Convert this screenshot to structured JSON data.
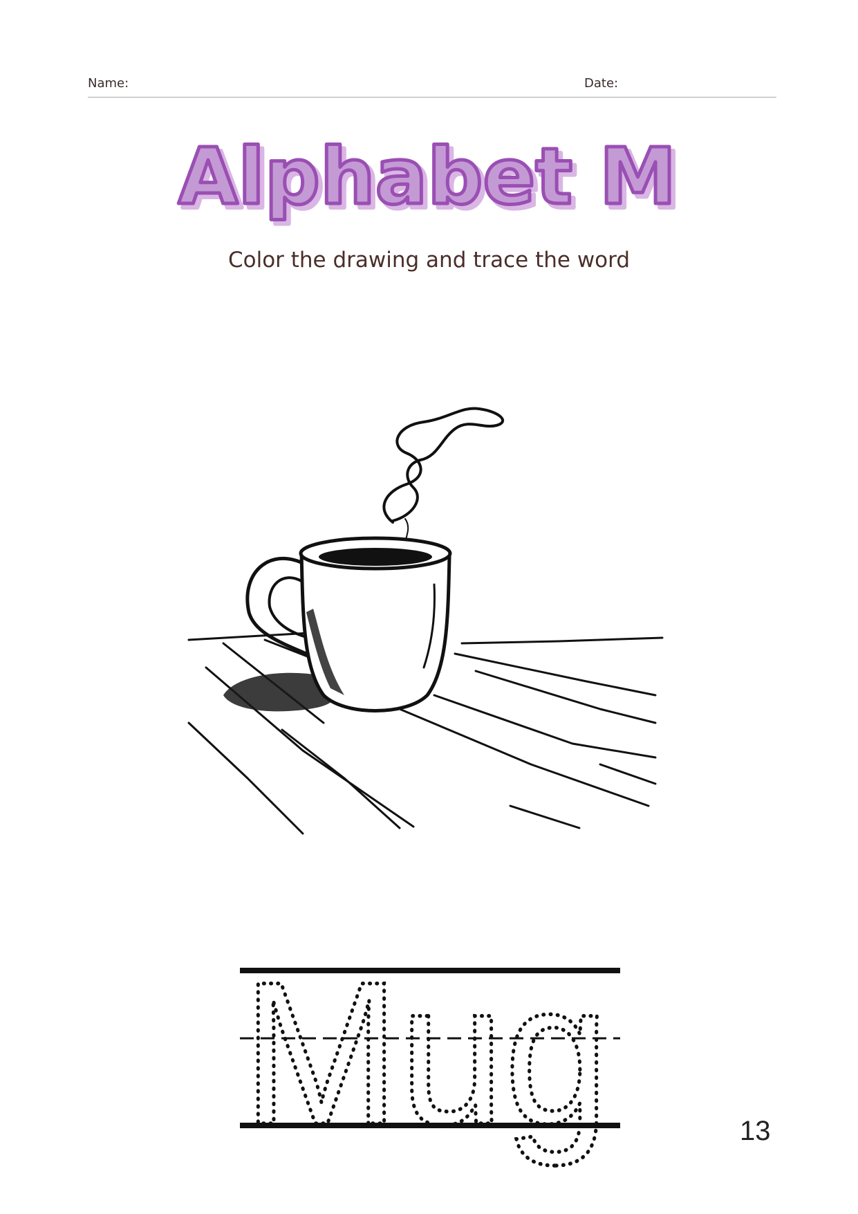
{
  "header": {
    "name_label": "Name:",
    "date_label": "Date:"
  },
  "title": "Alphabet M",
  "subtitle": "Color the drawing and trace the word",
  "trace_word": "Mug",
  "page_number": "13",
  "colors": {
    "title_fill": "#c49ad4",
    "title_outline": "#9a4fb3",
    "title_shadow": "#d9b6e4",
    "subtitle_text": "#4a2e2a",
    "guide_lines": "#111111",
    "header_rule": "#a8a8a8"
  },
  "icons": {
    "drawing": "steaming-mug-on-table-illustration"
  }
}
